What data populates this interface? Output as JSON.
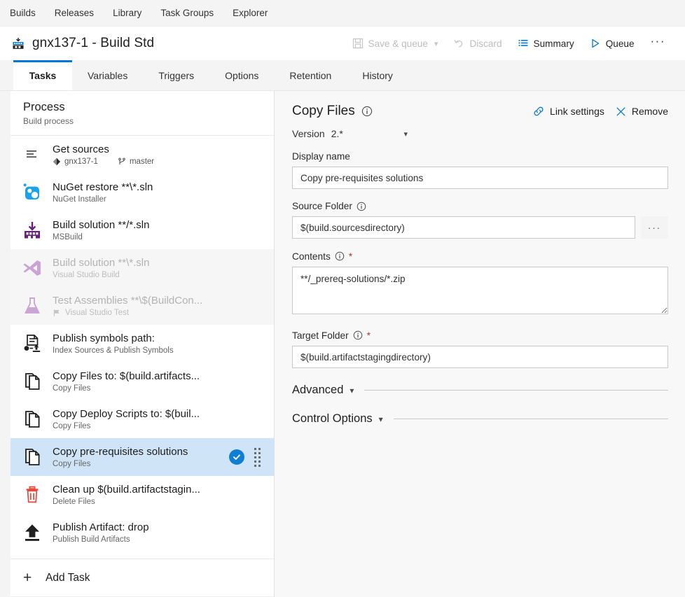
{
  "topnav": {
    "items": [
      {
        "label": "Builds"
      },
      {
        "label": "Releases"
      },
      {
        "label": "Library"
      },
      {
        "label": "Task Groups"
      },
      {
        "label": "Explorer"
      }
    ]
  },
  "header": {
    "title": "gnx137-1 - Build Std",
    "build_icon": "build-definition-icon",
    "actions": [
      {
        "label": "Save & queue",
        "icon": "save-icon",
        "disabled": true,
        "chevron": true
      },
      {
        "label": "Discard",
        "icon": "undo-icon",
        "disabled": true,
        "chevron": false
      },
      {
        "label": "Summary",
        "icon": "list-icon",
        "disabled": false,
        "chevron": false
      },
      {
        "label": "Queue",
        "icon": "play-icon",
        "disabled": false,
        "chevron": false
      }
    ],
    "overflow_label": "···"
  },
  "tabs": [
    {
      "label": "Tasks",
      "active": true
    },
    {
      "label": "Variables",
      "active": false
    },
    {
      "label": "Triggers",
      "active": false
    },
    {
      "label": "Options",
      "active": false
    },
    {
      "label": "Retention",
      "active": false
    },
    {
      "label": "History",
      "active": false
    }
  ],
  "sidebar": {
    "process": {
      "title": "Process",
      "subtitle": "Build process"
    },
    "tasks": [
      {
        "name": "Get sources",
        "icon": "get-sources-icon",
        "repo": "gnx137-1",
        "branch": "master",
        "subtitle": "",
        "disabled": false,
        "selected": false
      },
      {
        "name": "NuGet restore **\\*.sln",
        "icon": "nuget-icon",
        "subtitle": "NuGet Installer",
        "disabled": false,
        "selected": false
      },
      {
        "name": "Build solution **/*.sln",
        "icon": "msbuild-icon",
        "subtitle": "MSBuild",
        "disabled": false,
        "selected": false
      },
      {
        "name": "Build solution **\\*.sln",
        "icon": "visual-studio-icon",
        "subtitle": "Visual Studio Build",
        "disabled": true,
        "selected": false
      },
      {
        "name": "Test Assemblies **\\$(BuildCon...",
        "icon": "test-flask-icon",
        "subtitle": "Visual Studio Test",
        "disabled": true,
        "selected": false
      },
      {
        "name": "Publish symbols path:",
        "icon": "publish-symbols-icon",
        "subtitle": "Index Sources & Publish Symbols",
        "disabled": false,
        "selected": false
      },
      {
        "name": "Copy Files to: $(build.artifacts...",
        "icon": "copy-files-icon",
        "subtitle": "Copy Files",
        "disabled": false,
        "selected": false
      },
      {
        "name": "Copy Deploy Scripts to: $(buil...",
        "icon": "copy-files-icon",
        "subtitle": "Copy Files",
        "disabled": false,
        "selected": false
      },
      {
        "name": "Copy pre-requisites solutions",
        "icon": "copy-files-icon",
        "subtitle": "Copy Files",
        "disabled": false,
        "selected": true
      },
      {
        "name": "Clean up $(build.artifactstagin...",
        "icon": "delete-files-icon",
        "subtitle": "Delete Files",
        "disabled": false,
        "selected": false
      },
      {
        "name": "Publish Artifact: drop",
        "icon": "publish-artifact-icon",
        "subtitle": "Publish Build Artifacts",
        "disabled": false,
        "selected": false
      }
    ],
    "add_task": {
      "label": "Add Task",
      "icon": "plus-icon"
    }
  },
  "panel": {
    "title": "Copy Files",
    "title_info_icon": "info-icon",
    "actions": [
      {
        "label": "Link settings",
        "icon": "link-icon"
      },
      {
        "label": "Remove",
        "icon": "close-icon"
      }
    ],
    "version": {
      "label": "Version",
      "value": "2.*",
      "chevron_icon": "chevron-down-icon"
    },
    "fields": [
      {
        "label": "Display name",
        "value": "Copy pre-requisites solutions",
        "type": "text",
        "info": false,
        "required": false,
        "browse": false
      },
      {
        "label": "Source Folder",
        "value": "$(build.sourcesdirectory)",
        "type": "text",
        "info": true,
        "required": false,
        "browse": true,
        "browse_label": "···"
      },
      {
        "label": "Contents",
        "value": "**/_prereq-solutions/*.zip",
        "type": "textarea",
        "info": true,
        "required": true,
        "browse": false
      },
      {
        "label": "Target Folder",
        "value": "$(build.artifactstagingdirectory)",
        "type": "text",
        "info": true,
        "required": true,
        "browse": false
      }
    ],
    "sections": [
      {
        "label": "Advanced",
        "chevron_icon": "chevron-down-icon"
      },
      {
        "label": "Control Options",
        "chevron_icon": "chevron-down-icon"
      }
    ]
  },
  "colors": {
    "accent": "#0078d4",
    "selected_row": "#cfe4f7",
    "check_badge": "#0f7fd4",
    "required_star": "#b8382f",
    "panel_bg": "#f8f8f8",
    "nav_bg": "#f4f4f4",
    "delete_icon": "#e8483a",
    "msbuild_icon": "#68217a",
    "nuget_icon": "#1aa3e8"
  }
}
